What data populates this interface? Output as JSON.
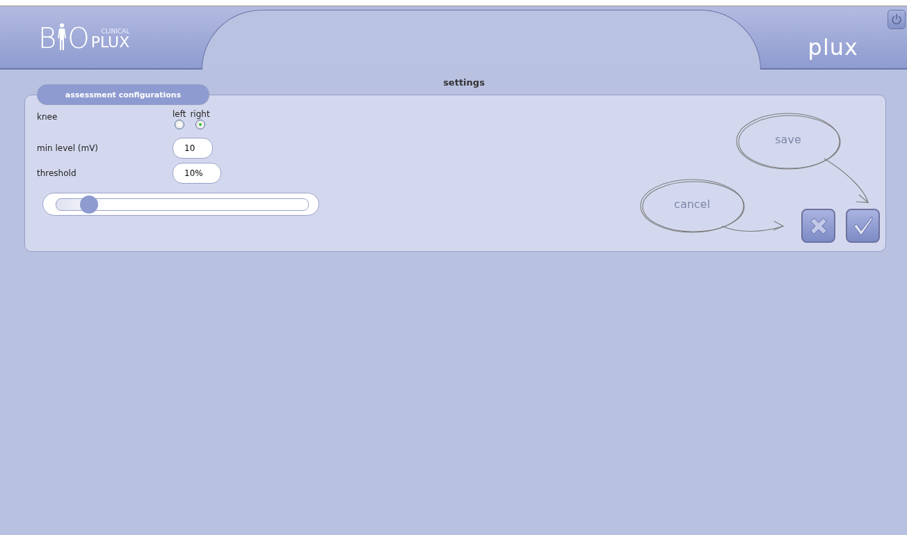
{
  "header": {
    "logo": {
      "lead": "B",
      "tail": "O",
      "superscript": "CLINICAL",
      "subscript": "PLUX"
    },
    "brand": "plux"
  },
  "title": "settings",
  "panel": {
    "tab": "assessment configurations",
    "knee": {
      "label": "knee",
      "options": [
        {
          "label": "left",
          "selected": false
        },
        {
          "label": "right",
          "selected": true
        }
      ]
    },
    "fields": [
      {
        "label": "min level (mV)",
        "value": "10"
      },
      {
        "label": "threshold",
        "value": "10%"
      }
    ],
    "slider": {
      "level": 0.1
    },
    "hints": [
      {
        "kind": "save",
        "label": "save"
      },
      {
        "kind": "cancel",
        "label": "cancel"
      }
    ],
    "buttons": [
      {
        "kind": "cancel"
      },
      {
        "kind": "confirm"
      }
    ]
  }
}
